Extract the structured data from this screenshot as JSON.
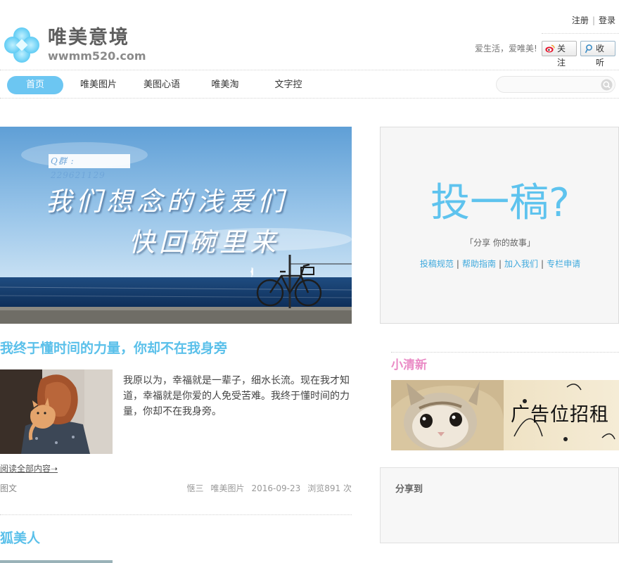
{
  "site": {
    "name": "唯美意境",
    "domain": "wwmm520.com",
    "slogan": "爱生活，爱唯美!",
    "follow_label": "关注",
    "listen_label": "收听",
    "register_label": "注册",
    "login_label": "登录",
    "link_separator": "|"
  },
  "nav": {
    "items": [
      {
        "label": "首页",
        "active": true
      },
      {
        "label": "唯美图片",
        "active": false
      },
      {
        "label": "美图心语",
        "active": false
      },
      {
        "label": "唯美淘",
        "active": false
      },
      {
        "label": "文字控",
        "active": false
      }
    ],
    "search_value": ""
  },
  "banner": {
    "qq_group": "Q群 : 229621129",
    "line1": "我们想念的浅爱们",
    "line2": "快回碗里来"
  },
  "posts": [
    {
      "title": "我终于懂时间的力量，你却不在我身旁",
      "excerpt": "我原以为，幸福就是一辈子，细水长流。现在我才知道，幸福就是你爱的人免受苦难。我终于懂时间的力量，你却不在我身旁。",
      "read_more": "阅读全部内容➝",
      "type": "图文",
      "author": "惬三",
      "category": "唯美图片",
      "date": "2016-09-23",
      "views": "浏览891 次"
    },
    {
      "title": "狐美人"
    }
  ],
  "sidebar": {
    "submit_title": "投一稿?",
    "submit_sub": "「分享 你的故事」",
    "submit_links": [
      "投稿规范",
      "帮助指南",
      "加入我们",
      "专栏申请"
    ],
    "links_separator": "|",
    "section_title": "小清新",
    "ad_text": "广告位招租",
    "share_title": "分享到"
  },
  "colors": {
    "accent": "#6cc6f2",
    "title_blue": "#5ac0ea",
    "pink": "#ea8cc6"
  },
  "icons": {
    "logo": "clover-logo-icon",
    "weibo": "weibo-icon",
    "tencent": "tencent-weibo-icon",
    "search": "search-icon"
  }
}
